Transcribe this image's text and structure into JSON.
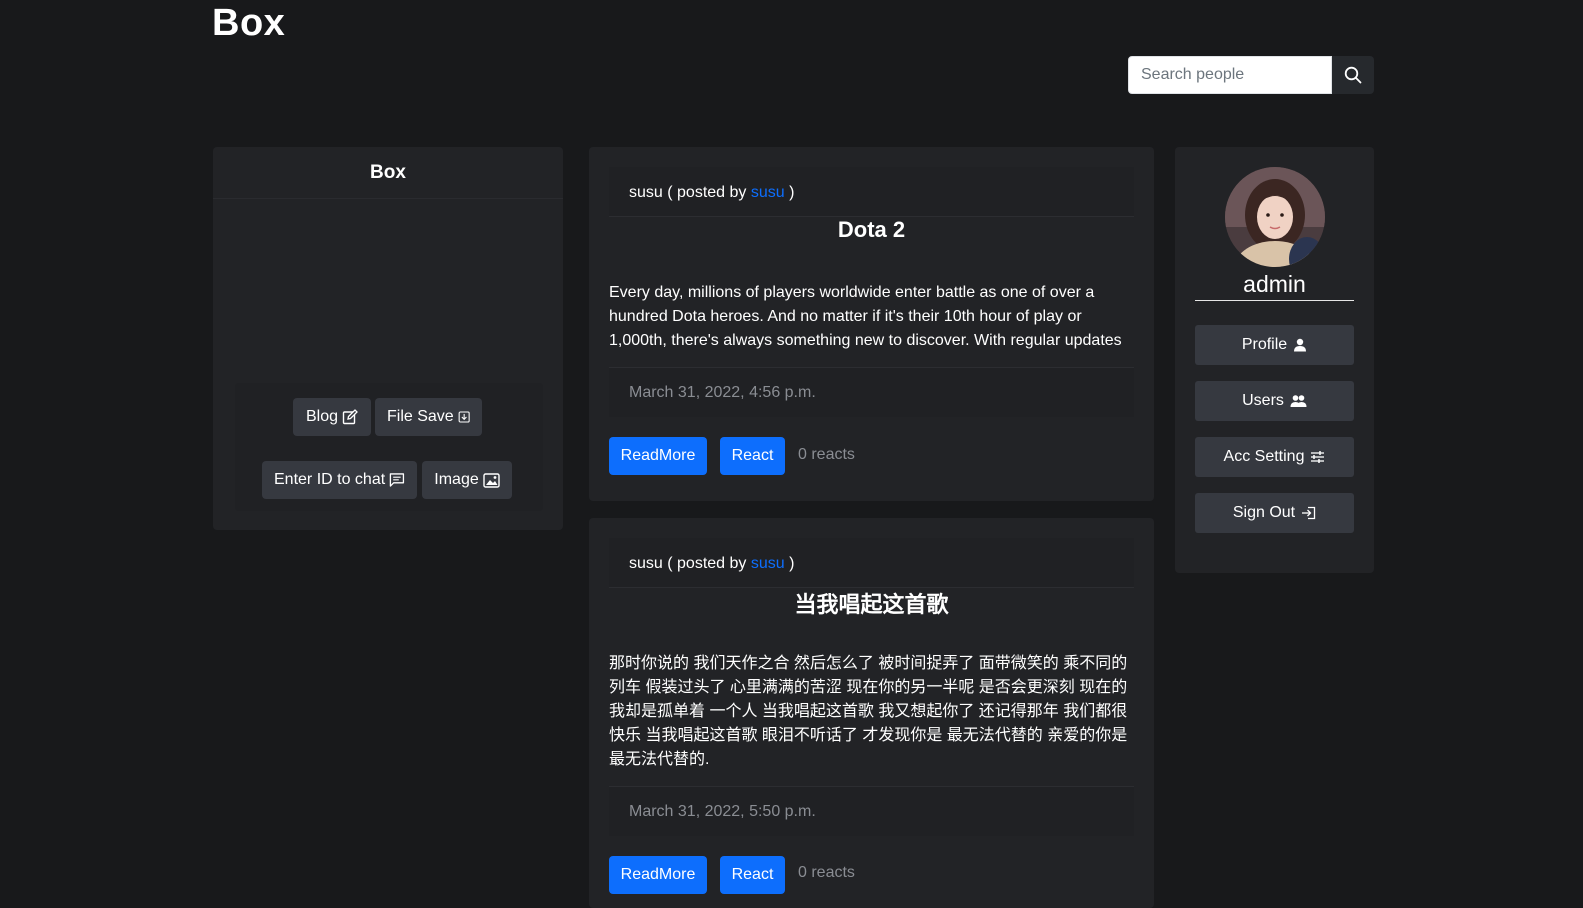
{
  "brand": "Box",
  "search": {
    "placeholder": "Search people"
  },
  "left_panel": {
    "title": "Box",
    "buttons": {
      "blog": "Blog",
      "file_save": "File Save",
      "enter_chat": "Enter ID to chat",
      "image": "Image"
    }
  },
  "posts": [
    {
      "author": "susu",
      "posted_by_prefix": "( posted by",
      "posted_by": "susu",
      "posted_by_suffix": ")",
      "title": "Dota 2",
      "body": "Every day, millions of players worldwide enter battle as one of over a hundred Dota heroes. And no matter if it's their 10th hour of play or 1,000th, there's always something new to discover. With regular updates ...",
      "date": "March 31, 2022, 4:56 p.m.",
      "readmore": "ReadMore",
      "react": "React",
      "reacts": "0 reacts"
    },
    {
      "author": "susu",
      "posted_by_prefix": "( posted by",
      "posted_by": "susu",
      "posted_by_suffix": ")",
      "title": "当我唱起这首歌",
      "body": "那时你说的 我们天作之合 然后怎么了 被时间捉弄了 面带微笑的 乘不同的列车 假装过头了 心里满满的苦涩 现在你的另一半呢 是否会更深刻 现在的我却是孤单着 一个人 当我唱起这首歌 我又想起你了 还记得那年 我们都很快乐 当我唱起这首歌 眼泪不听话了 才发现你是 最无法代替的 亲爱的你是最无法代替的.",
      "date": "March 31, 2022, 5:50 p.m.",
      "readmore": "ReadMore",
      "react": "React",
      "reacts": "0 reacts"
    }
  ],
  "profile": {
    "username": "admin",
    "nav": {
      "profile": "Profile",
      "users": "Users",
      "acc_setting": "Acc Setting",
      "sign_out": "Sign Out"
    }
  },
  "colors": {
    "background": "#18191b",
    "panel": "#222326",
    "accent": "#0d6efd",
    "button_dark": "#363940"
  }
}
